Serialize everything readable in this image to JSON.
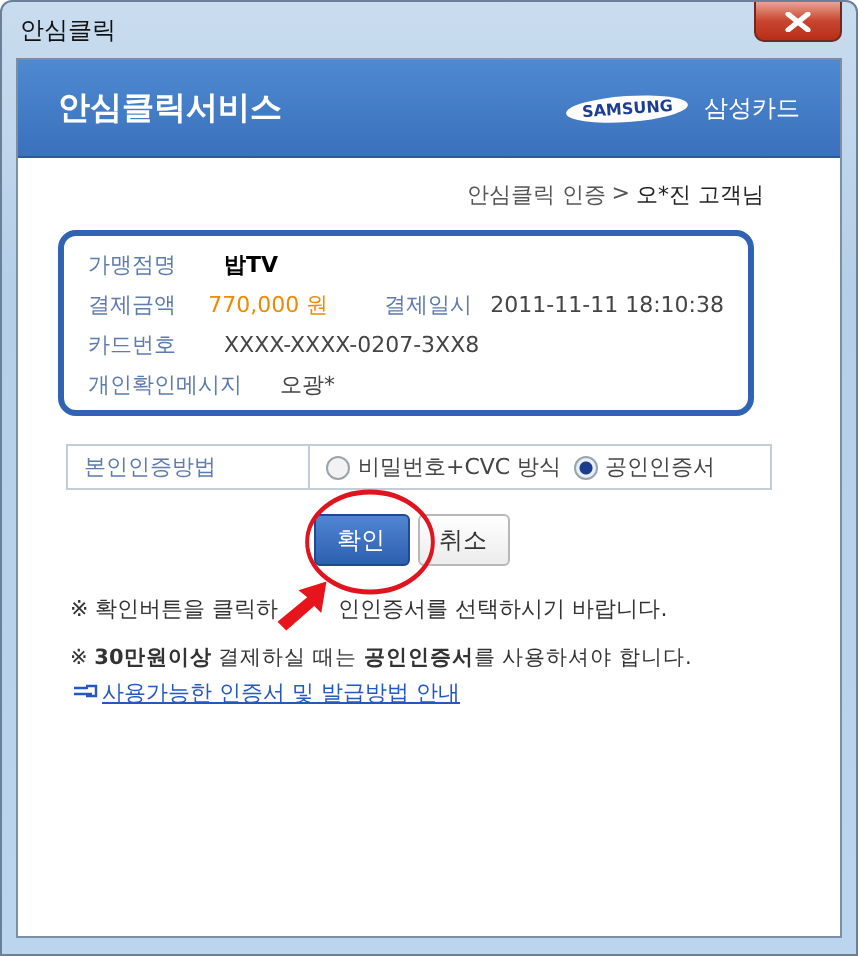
{
  "window": {
    "title": "안심클릭"
  },
  "header": {
    "title": "안심클릭서비스",
    "logo": "SAMSUNG",
    "brand": "삼성카드"
  },
  "breadcrumb": {
    "path": "안심클릭 인증",
    "separator": ">",
    "user": "오*진 고객님"
  },
  "info": [
    {
      "kind": "merchant",
      "label": "가맹점명",
      "value": "밥TV"
    },
    {
      "kind": "amount",
      "label": "결제금액",
      "value": "770,000 원",
      "label2": "결제일시",
      "value2": "2011-11-11 18:10:38"
    },
    {
      "kind": "plain",
      "label": "카드번호",
      "value": "XXXX-XXXX-0207-3XX8"
    },
    {
      "kind": "plain",
      "label": "개인확인메시지",
      "value": "오광*"
    }
  ],
  "auth_method": {
    "label": "본인인증방법",
    "options": [
      {
        "label": "비밀번호+CVC 방식",
        "selected": false
      },
      {
        "label": "공인인증서",
        "selected": true
      }
    ]
  },
  "buttons": [
    {
      "label": "확인",
      "kind": "primary"
    },
    {
      "label": "취소",
      "kind": "secondary"
    }
  ],
  "notice_1": {
    "before": "※ 확인버튼을 클릭하",
    "after": "인인증서를 선택하시기 바랍니다."
  },
  "notice_2": {
    "text": "※ **30만원이상** 결제하실 때는 **공인인증서**를 사용하셔야 합니다.",
    "link": "사용가능한 인증서 및 발급방법 안내"
  }
}
